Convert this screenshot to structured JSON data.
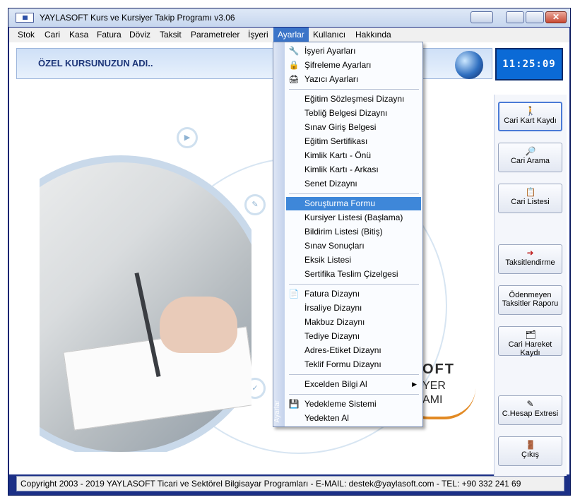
{
  "window": {
    "title": "YAYLASOFT Kurs ve Kursiyer Takip Programı v3.06",
    "close_label": "✕"
  },
  "menubar": [
    "Stok",
    "Cari",
    "Kasa",
    "Fatura",
    "Döviz",
    "Taksit",
    "Parametreler",
    "İşyeri",
    "Ayarlar",
    "Kullanıcı",
    "Hakkında"
  ],
  "header": {
    "school_name": "ÖZEL KURSUNUZUN ADI..",
    "clock": "11:25:09"
  },
  "dropdown": {
    "strip_label": "Ayarlar",
    "items": [
      {
        "label": "İşyeri Ayarları",
        "icon": "🔧"
      },
      {
        "label": "Şifreleme Ayarları",
        "icon": "🔒"
      },
      {
        "label": "Yazıcı Ayarları",
        "icon": "🖨"
      },
      {
        "label": "Eğitim Sözleşmesi Dizaynı",
        "icon": ""
      },
      {
        "label": "Tebliğ Belgesi Dizaynı",
        "icon": ""
      },
      {
        "label": "Sınav Giriş Belgesi",
        "icon": ""
      },
      {
        "label": "Eğitim Sertifikası",
        "icon": ""
      },
      {
        "label": "Kimlik Kartı - Önü",
        "icon": ""
      },
      {
        "label": "Kimlik Kartı - Arkası",
        "icon": ""
      },
      {
        "label": "Senet Dizaynı",
        "icon": ""
      },
      {
        "label": "Soruşturma Formu",
        "icon": ""
      },
      {
        "label": "Kursiyer Listesi (Başlama)",
        "icon": ""
      },
      {
        "label": "Bildirim Listesi (Bitiş)",
        "icon": ""
      },
      {
        "label": "Sınav Sonuçları",
        "icon": ""
      },
      {
        "label": "Eksik Listesi",
        "icon": ""
      },
      {
        "label": "Sertifika Teslim Çizelgesi",
        "icon": ""
      },
      {
        "label": "Fatura Dizaynı",
        "icon": "📄"
      },
      {
        "label": "İrsaliye Dizaynı",
        "icon": ""
      },
      {
        "label": "Makbuz Dizaynı",
        "icon": ""
      },
      {
        "label": "Tediye Dizaynı",
        "icon": ""
      },
      {
        "label": "Adres-Etiket Dizaynı",
        "icon": ""
      },
      {
        "label": "Teklif Formu Dizaynı",
        "icon": ""
      },
      {
        "label": "Excelden Bilgi Al",
        "icon": ""
      },
      {
        "label": "Yedekleme Sistemi",
        "icon": "💾"
      },
      {
        "label": "Yedekten Al",
        "icon": ""
      }
    ],
    "submenu_arrow": "▶"
  },
  "side_buttons": [
    {
      "label": "Cari Kart Kaydı",
      "icon": "🚶"
    },
    {
      "label": "Cari Arama",
      "icon": "🔎"
    },
    {
      "label": "Cari Listesi",
      "icon": "📋"
    },
    {
      "label": "Taksitlendirme",
      "icon": "➜"
    },
    {
      "label": "Ödenmeyen Taksitler Raporu",
      "icon": ""
    },
    {
      "label": "Cari Hareket Kaydı",
      "icon": "🗂"
    },
    {
      "label": "C.Hesap Extresi",
      "icon": "✎"
    },
    {
      "label": "Çıkış",
      "icon": "🚪"
    }
  ],
  "background": {
    "brand_fragment": "OFT",
    "brand_line2": "YER",
    "brand_line3": "AMI"
  },
  "statusbar": "Copyright 2003 - 2019 YAYLASOFT Ticari ve Sektörel Bilgisayar Programları  -  E-MAIL: destek@yaylasoft.com  -  TEL: +90 332 241 69",
  "colors": {
    "frame": "#1b2f86",
    "highlight": "#3e87d9",
    "clock_bg": "#0b6ad6"
  }
}
